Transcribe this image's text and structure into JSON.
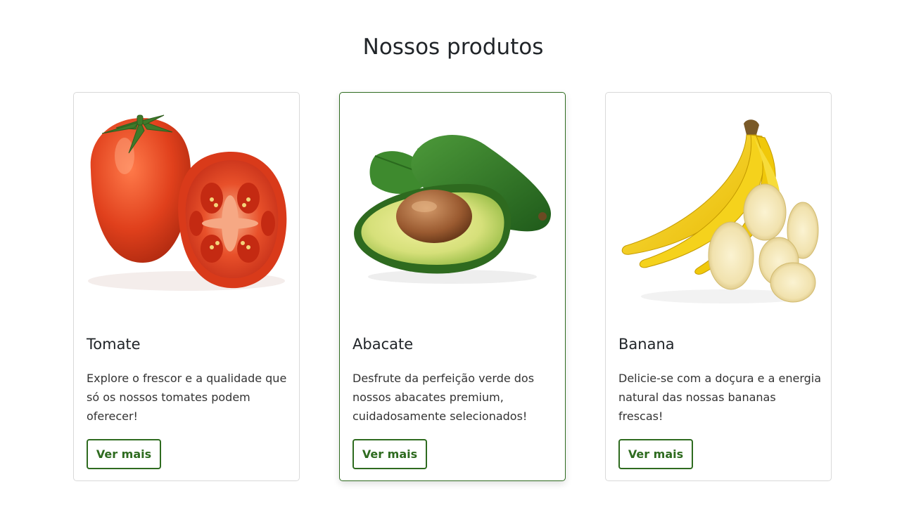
{
  "section": {
    "title": "Nossos produtos"
  },
  "products": [
    {
      "name": "Tomate",
      "description": "Explore o frescor e a qualidade que só os nossos tomates podem oferecer!",
      "button_label": "Ver mais",
      "image_icon": "tomato-image"
    },
    {
      "name": "Abacate",
      "description": "Desfrute da perfeição verde dos nossos abacates premium, cuidadosamente selecionados!",
      "button_label": "Ver mais",
      "image_icon": "avocado-image"
    },
    {
      "name": "Banana",
      "description": "Delicie-se com a doçura e a energia natural das nossas bananas frescas!",
      "button_label": "Ver mais",
      "image_icon": "banana-image"
    }
  ],
  "colors": {
    "accent": "#2e6b1f",
    "card_border": "#d9d9d9",
    "text": "#212529"
  }
}
